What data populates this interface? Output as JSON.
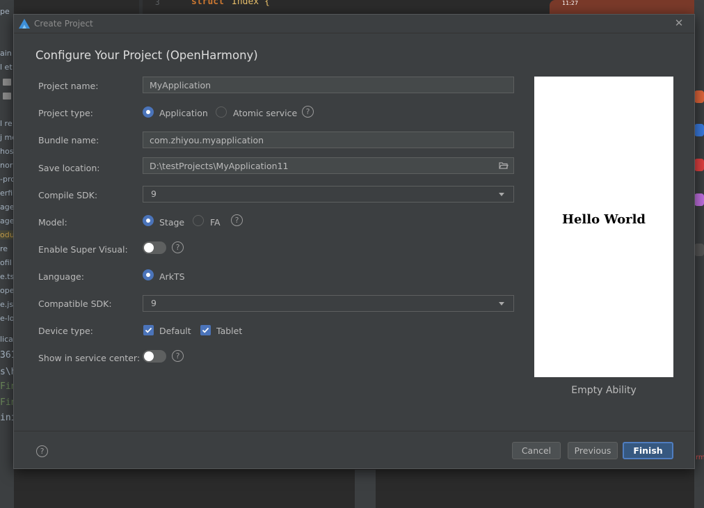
{
  "background": {
    "editor": {
      "line_number": "3",
      "keyword": "struct",
      "name": "Index {"
    },
    "left_panel_rows": [
      "pe",
      "ain",
      "l et",
      "l re",
      "j mo",
      "hos",
      "nor",
      "-pro",
      "erfil",
      "age",
      "age",
      "odu",
      "re",
      "ofil",
      "e.ts",
      "ope",
      "e.jso",
      "e-lo",
      "lica",
      "361",
      "s\\h",
      "Fin",
      "Fin",
      "ini"
    ],
    "phone_time": "11:27",
    "right_text": "rm"
  },
  "dialog": {
    "title": "Create Project",
    "heading": "Configure Your Project (OpenHarmony)",
    "fields": {
      "project_name": {
        "label": "Project name:",
        "value": "MyApplication"
      },
      "project_type": {
        "label": "Project type:",
        "options": [
          "Application",
          "Atomic service"
        ],
        "selected": "Application"
      },
      "bundle_name": {
        "label": "Bundle name:",
        "value": "com.zhiyou.myapplication"
      },
      "save_location": {
        "label": "Save location:",
        "value": "D:\\testProjects\\MyApplication11"
      },
      "compile_sdk": {
        "label": "Compile SDK:",
        "value": "9"
      },
      "model": {
        "label": "Model:",
        "options": [
          "Stage",
          "FA"
        ],
        "selected": "Stage"
      },
      "super_visual": {
        "label": "Enable Super Visual:",
        "enabled": false
      },
      "language": {
        "label": "Language:",
        "options": [
          "ArkTS"
        ],
        "selected": "ArkTS"
      },
      "compatible_sdk": {
        "label": "Compatible SDK:",
        "value": "9"
      },
      "device_type": {
        "label": "Device type:",
        "options": [
          "Default",
          "Tablet"
        ],
        "checked": [
          "Default",
          "Tablet"
        ]
      },
      "service_center": {
        "label": "Show in service center:",
        "enabled": false
      }
    },
    "preview": {
      "text": "Hello World",
      "caption": "Empty Ability"
    },
    "buttons": {
      "cancel": "Cancel",
      "previous": "Previous",
      "finish": "Finish"
    },
    "help_glyph": "?"
  },
  "colors": {
    "accent": "#4b74ba",
    "dialog_bg": "#3c3f41",
    "primary_button": "#365880"
  }
}
